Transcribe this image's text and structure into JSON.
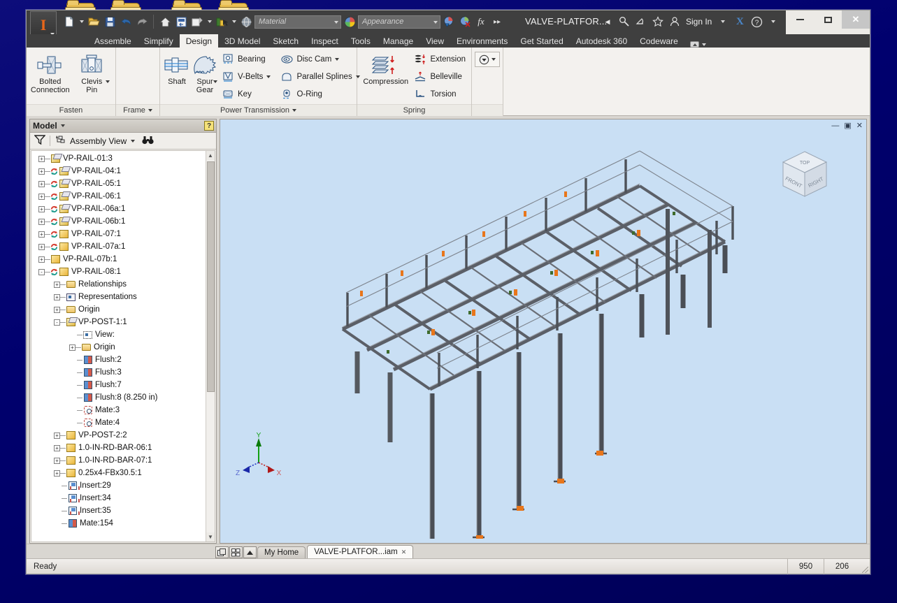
{
  "desktop": {
    "folder_count": 4
  },
  "window": {
    "title": "VALVE-PLATFOR...",
    "minimize": "—",
    "maximize": "▢",
    "close": "✕"
  },
  "quick_access": {
    "items": [
      {
        "name": "new-file-icon",
        "label": "New",
        "has_caret": true
      },
      {
        "name": "open-file-icon",
        "label": "Open",
        "has_caret": false
      },
      {
        "name": "save-icon",
        "label": "Save",
        "has_caret": false
      },
      {
        "name": "undo-icon",
        "label": "Undo",
        "has_caret": false
      },
      {
        "name": "redo-icon",
        "label": "Redo",
        "has_caret": false
      },
      {
        "name": "home-icon",
        "label": "Home",
        "has_caret": false
      },
      {
        "name": "return-icon",
        "label": "Return",
        "has_caret": false
      },
      {
        "name": "update-icon",
        "label": "Update",
        "has_caret": true
      },
      {
        "name": "select-icon",
        "label": "Select",
        "has_caret": true
      },
      {
        "name": "appearance-globe-icon",
        "label": "Appearance Globe",
        "has_caret": false
      }
    ],
    "material_placeholder": "Material",
    "appearance_placeholder": "Appearance",
    "adjust_label": "fx",
    "overflow_label": "▸▸"
  },
  "title_right": {
    "search_icon": "search-icon",
    "signin_label": "Sign In",
    "exchange_label": "X",
    "help_label": "?"
  },
  "ribbon_tabs": [
    {
      "label": "Assemble",
      "active": false
    },
    {
      "label": "Simplify",
      "active": false
    },
    {
      "label": "Design",
      "active": true
    },
    {
      "label": "3D Model",
      "active": false
    },
    {
      "label": "Sketch",
      "active": false
    },
    {
      "label": "Inspect",
      "active": false
    },
    {
      "label": "Tools",
      "active": false
    },
    {
      "label": "Manage",
      "active": false
    },
    {
      "label": "View",
      "active": false
    },
    {
      "label": "Environments",
      "active": false
    },
    {
      "label": "Get Started",
      "active": false
    },
    {
      "label": "Autodesk 360",
      "active": false
    },
    {
      "label": "Codeware",
      "active": false
    }
  ],
  "ribbon_panels": [
    {
      "name": "fasten",
      "label": "Fasten",
      "has_dropdown": false,
      "big_buttons": [
        {
          "label_line1": "Bolted",
          "label_line2": "Connection",
          "icon": "bolted-connection-icon",
          "has_caret": false
        },
        {
          "label_line1": "Clevis",
          "label_line2": "Pin",
          "icon": "clevis-pin-icon",
          "has_caret": true
        }
      ],
      "small_buttons": []
    },
    {
      "name": "frame",
      "label": "Frame",
      "has_dropdown": true,
      "big_buttons": [],
      "small_buttons": []
    },
    {
      "name": "power-transmission",
      "label": "Power Transmission",
      "has_dropdown": true,
      "big_buttons": [
        {
          "label_line1": "Shaft",
          "label_line2": "",
          "icon": "shaft-icon",
          "has_caret": false
        },
        {
          "label_line1": "Spur",
          "label_line2": "Gear",
          "icon": "spur-gear-icon",
          "has_caret": true
        }
      ],
      "small_buttons": [
        {
          "label": "Bearing",
          "icon": "bearing-icon",
          "has_caret": false
        },
        {
          "label": "V-Belts",
          "icon": "v-belts-icon",
          "has_caret": true
        },
        {
          "label": "Key",
          "icon": "key-icon",
          "has_caret": false
        },
        {
          "label": "Disc Cam",
          "icon": "disc-cam-icon",
          "has_caret": true
        },
        {
          "label": "Parallel Splines",
          "icon": "parallel-splines-icon",
          "has_caret": true
        },
        {
          "label": "O-Ring",
          "icon": "o-ring-icon",
          "has_caret": false
        }
      ]
    },
    {
      "name": "spring",
      "label": "Spring",
      "has_dropdown": false,
      "big_buttons": [
        {
          "label_line1": "Compression",
          "label_line2": "",
          "icon": "compression-spring-icon",
          "has_caret": false
        }
      ],
      "small_buttons": [
        {
          "label": "Extension",
          "icon": "extension-spring-icon",
          "has_caret": false
        },
        {
          "label": "Belleville",
          "icon": "belleville-spring-icon",
          "has_caret": false
        },
        {
          "label": "Torsion",
          "icon": "torsion-spring-icon",
          "has_caret": false
        }
      ]
    }
  ],
  "ribbon_overflow": {
    "name": "panel-overflow-button",
    "has_caret": true
  },
  "browser": {
    "title": "Model",
    "help_label": "?",
    "close_label": "✕",
    "toolbar": {
      "filter_icon": "filter-icon",
      "view_mode": "Assembly View",
      "find_icon": "binoculars-icon"
    },
    "tree": [
      {
        "label": "VP-RAIL-01:3",
        "indent": 1,
        "expander": "+",
        "update": false,
        "icon": "assembly"
      },
      {
        "label": "VP-RAIL-04:1",
        "indent": 1,
        "expander": "+",
        "update": true,
        "icon": "assembly"
      },
      {
        "label": "VP-RAIL-05:1",
        "indent": 1,
        "expander": "+",
        "update": true,
        "icon": "assembly"
      },
      {
        "label": "VP-RAIL-06:1",
        "indent": 1,
        "expander": "+",
        "update": true,
        "icon": "assembly"
      },
      {
        "label": "VP-RAIL-06a:1",
        "indent": 1,
        "expander": "+",
        "update": true,
        "icon": "assembly"
      },
      {
        "label": "VP-RAIL-06b:1",
        "indent": 1,
        "expander": "+",
        "update": true,
        "icon": "assembly"
      },
      {
        "label": "VP-RAIL-07:1",
        "indent": 1,
        "expander": "+",
        "update": true,
        "icon": "part"
      },
      {
        "label": "VP-RAIL-07a:1",
        "indent": 1,
        "expander": "+",
        "update": true,
        "icon": "part"
      },
      {
        "label": "VP-RAIL-07b:1",
        "indent": 1,
        "expander": "+",
        "update": false,
        "icon": "part"
      },
      {
        "label": "VP-RAIL-08:1",
        "indent": 1,
        "expander": "-",
        "update": true,
        "icon": "part"
      },
      {
        "label": "Relationships",
        "indent": 2,
        "expander": "+",
        "update": false,
        "icon": "folder"
      },
      {
        "label": "Representations",
        "indent": 2,
        "expander": "+",
        "update": false,
        "icon": "rep"
      },
      {
        "label": "Origin",
        "indent": 2,
        "expander": "+",
        "update": false,
        "icon": "folder"
      },
      {
        "label": "VP-POST-1:1",
        "indent": 2,
        "expander": "-",
        "update": false,
        "icon": "assembly"
      },
      {
        "label": "View:",
        "indent": 3,
        "expander": "",
        "update": false,
        "icon": "view"
      },
      {
        "label": "Origin",
        "indent": 3,
        "expander": "+",
        "update": false,
        "icon": "folder"
      },
      {
        "label": "Flush:2",
        "indent": 3,
        "expander": "",
        "update": false,
        "icon": "flush"
      },
      {
        "label": "Flush:3",
        "indent": 3,
        "expander": "",
        "update": false,
        "icon": "flush"
      },
      {
        "label": "Flush:7",
        "indent": 3,
        "expander": "",
        "update": false,
        "icon": "flush"
      },
      {
        "label": "Flush:8 (8.250 in)",
        "indent": 3,
        "expander": "",
        "update": false,
        "icon": "flush"
      },
      {
        "label": "Mate:3",
        "indent": 3,
        "expander": "",
        "update": false,
        "icon": "mate"
      },
      {
        "label": "Mate:4",
        "indent": 3,
        "expander": "",
        "update": false,
        "icon": "mate"
      },
      {
        "label": "VP-POST-2:2",
        "indent": 2,
        "expander": "+",
        "update": false,
        "icon": "part"
      },
      {
        "label": "1.0-IN-RD-BAR-06:1",
        "indent": 2,
        "expander": "+",
        "update": false,
        "icon": "part"
      },
      {
        "label": "1.0-IN-RD-BAR-07:1",
        "indent": 2,
        "expander": "+",
        "update": false,
        "icon": "part"
      },
      {
        "label": "0.25x4-FBx30.5:1",
        "indent": 2,
        "expander": "+",
        "update": false,
        "icon": "part"
      },
      {
        "label": "Insert:29",
        "indent": 2,
        "expander": "",
        "update": false,
        "icon": "insert"
      },
      {
        "label": "Insert:34",
        "indent": 2,
        "expander": "",
        "update": false,
        "icon": "insert"
      },
      {
        "label": "Insert:35",
        "indent": 2,
        "expander": "",
        "update": false,
        "icon": "insert"
      },
      {
        "label": "Mate:154",
        "indent": 2,
        "expander": "",
        "update": false,
        "icon": "flush"
      }
    ]
  },
  "graphics": {
    "window_buttons": {
      "minimize": "—",
      "restore": "▣",
      "close": "✕"
    },
    "viewcube": {
      "top": "TOP",
      "front": "FRONT",
      "right": "RIGHT"
    },
    "axis_triad": {
      "x": "X",
      "y": "Y",
      "z": "Z"
    },
    "background_color": "#c9dff4",
    "model_color": "#52555c",
    "model_description": "Isometric view of a steel valve access platform assembly with handrails and support posts"
  },
  "doc_tabs": {
    "icons": [
      "tile-windows-icon",
      "arrange-icon",
      "scroll-up-icon"
    ],
    "tabs": [
      {
        "label": "My Home",
        "active": false,
        "closable": false
      },
      {
        "label": "VALVE-PLATFOR...iam",
        "active": true,
        "closable": true,
        "close": "✕"
      }
    ]
  },
  "status_bar": {
    "message": "Ready",
    "field_1": "950",
    "field_2": "206"
  }
}
